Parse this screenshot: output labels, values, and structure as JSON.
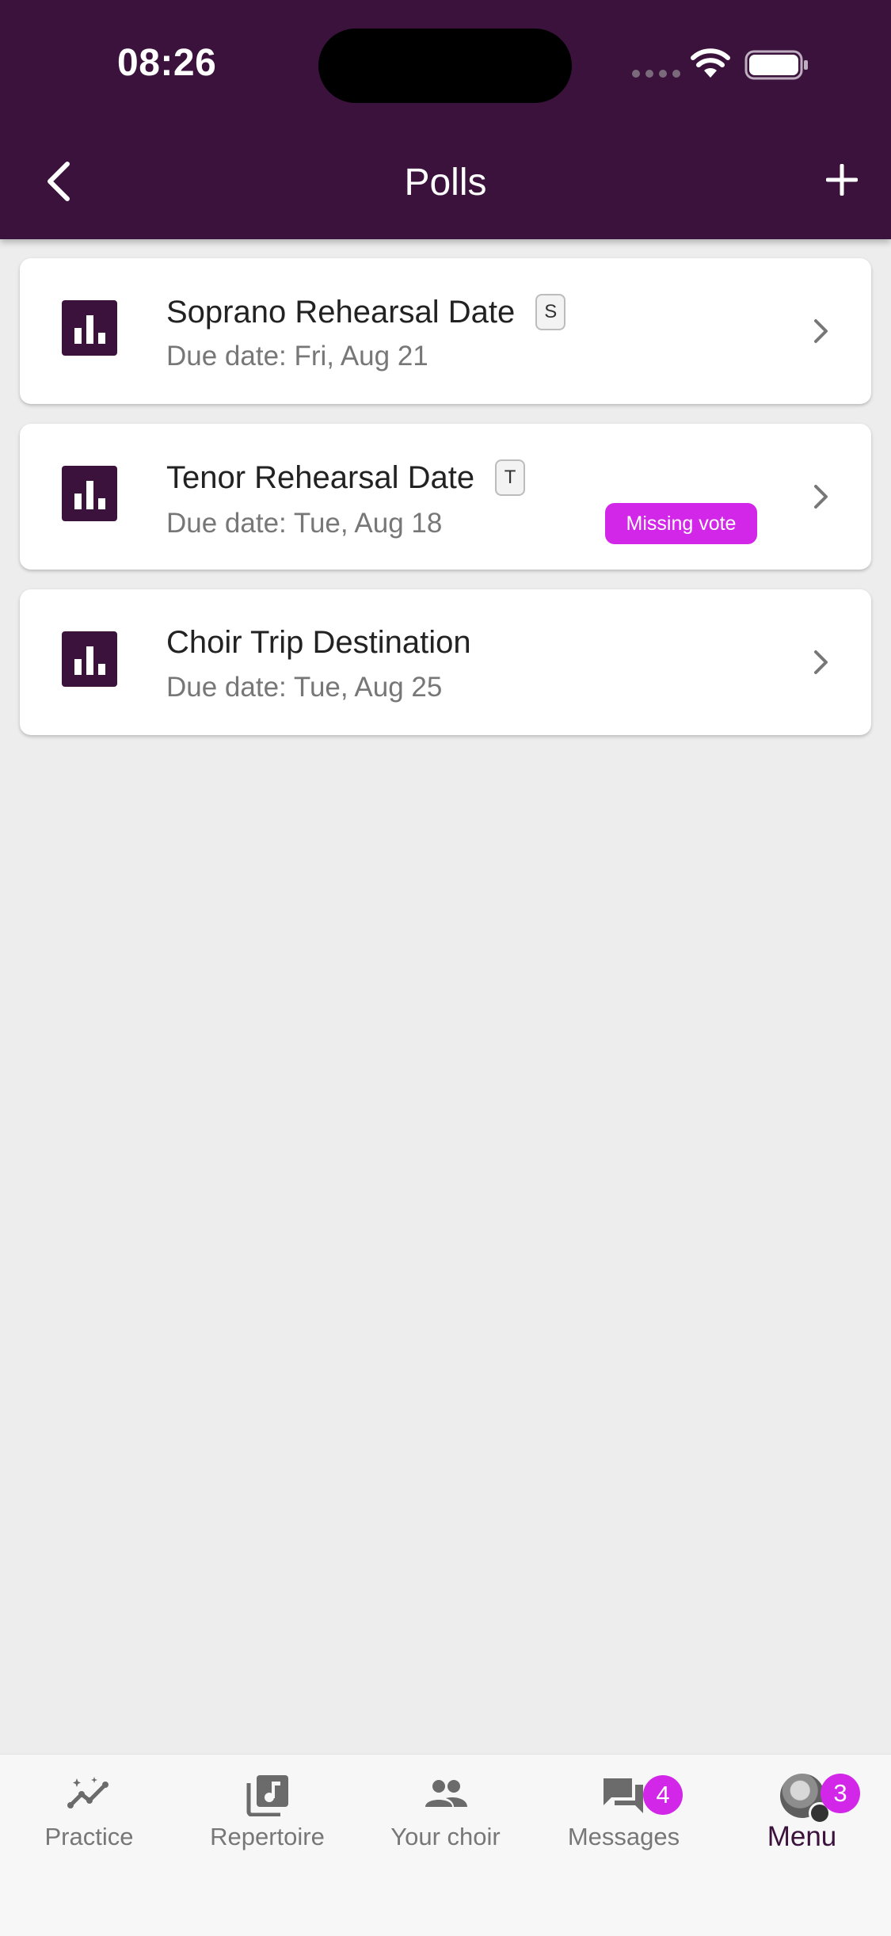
{
  "status_bar": {
    "time": "08:26"
  },
  "header": {
    "title": "Polls"
  },
  "polls": [
    {
      "title": "Soprano Rehearsal Date",
      "voice": "S",
      "due": "Due date: Fri, Aug 21"
    },
    {
      "title": "Tenor Rehearsal Date",
      "voice": "T",
      "due": "Due date: Tue, Aug 18",
      "status": "Missing vote"
    },
    {
      "title": "Choir Trip Destination",
      "due": "Due date: Tue, Aug 25"
    }
  ],
  "tabbar": {
    "items": [
      {
        "label": "Practice"
      },
      {
        "label": "Repertoire"
      },
      {
        "label": "Your choir"
      },
      {
        "label": "Messages",
        "badge": "4"
      },
      {
        "label": "Menu",
        "badge": "3"
      }
    ]
  },
  "colors": {
    "brand": "#3a123c",
    "accent": "#d226e8",
    "background": "#ededed"
  }
}
